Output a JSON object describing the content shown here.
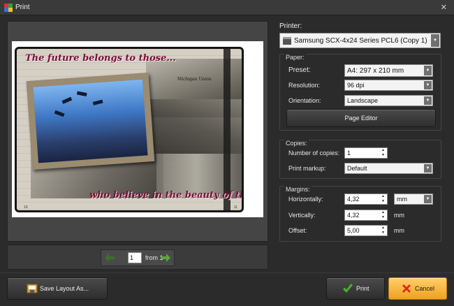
{
  "window": {
    "title": "Print",
    "close_symbol": "✕",
    "icon": "app-icon"
  },
  "preview": {
    "quote_top": "The future belongs to those...",
    "quote_bottom": "who believe in the beauty of their dreams",
    "sign_text": "Michigan  Union",
    "page_number_left": "10",
    "page_number_right": "11"
  },
  "pager": {
    "current_page": "1",
    "from_text": "from 1",
    "prev_icon": "arrow-left-icon",
    "next_icon": "arrow-right-icon"
  },
  "printer": {
    "label": "Printer:",
    "selected": "Samsung SCX-4x24 Series PCL6 (Copy 1)"
  },
  "paper": {
    "group_label": "Paper:",
    "preset_label": "Preset:",
    "preset_value": "A4: 297 x 210 mm",
    "resolution_label": "Resolution:",
    "resolution_value": "96 dpi",
    "orientation_label": "Orientation:",
    "orientation_value": "Landscape",
    "page_editor_label": "Page Editor"
  },
  "copies": {
    "group_label": "Copies:",
    "number_label": "Number of copies:",
    "number_value": "1",
    "markup_label": "Print markup:",
    "markup_value": "Default"
  },
  "margins": {
    "group_label": "Margins:",
    "horizontal_label": "Horizontally:",
    "horizontal_value": "4,32",
    "unit_select": "mm",
    "vertical_label": "Vertically:",
    "vertical_value": "4,32",
    "vertical_unit": "mm",
    "offset_label": "Offset:",
    "offset_value": "5,00",
    "offset_unit": "mm"
  },
  "buttons": {
    "save_layout": "Save Layout As...",
    "print": "Print",
    "cancel": "Cancel"
  },
  "colors": {
    "accent_cancel": "#f0a020",
    "quote": "#7a1037",
    "print_check": "#4caf28",
    "cancel_x": "#e02a1a"
  }
}
